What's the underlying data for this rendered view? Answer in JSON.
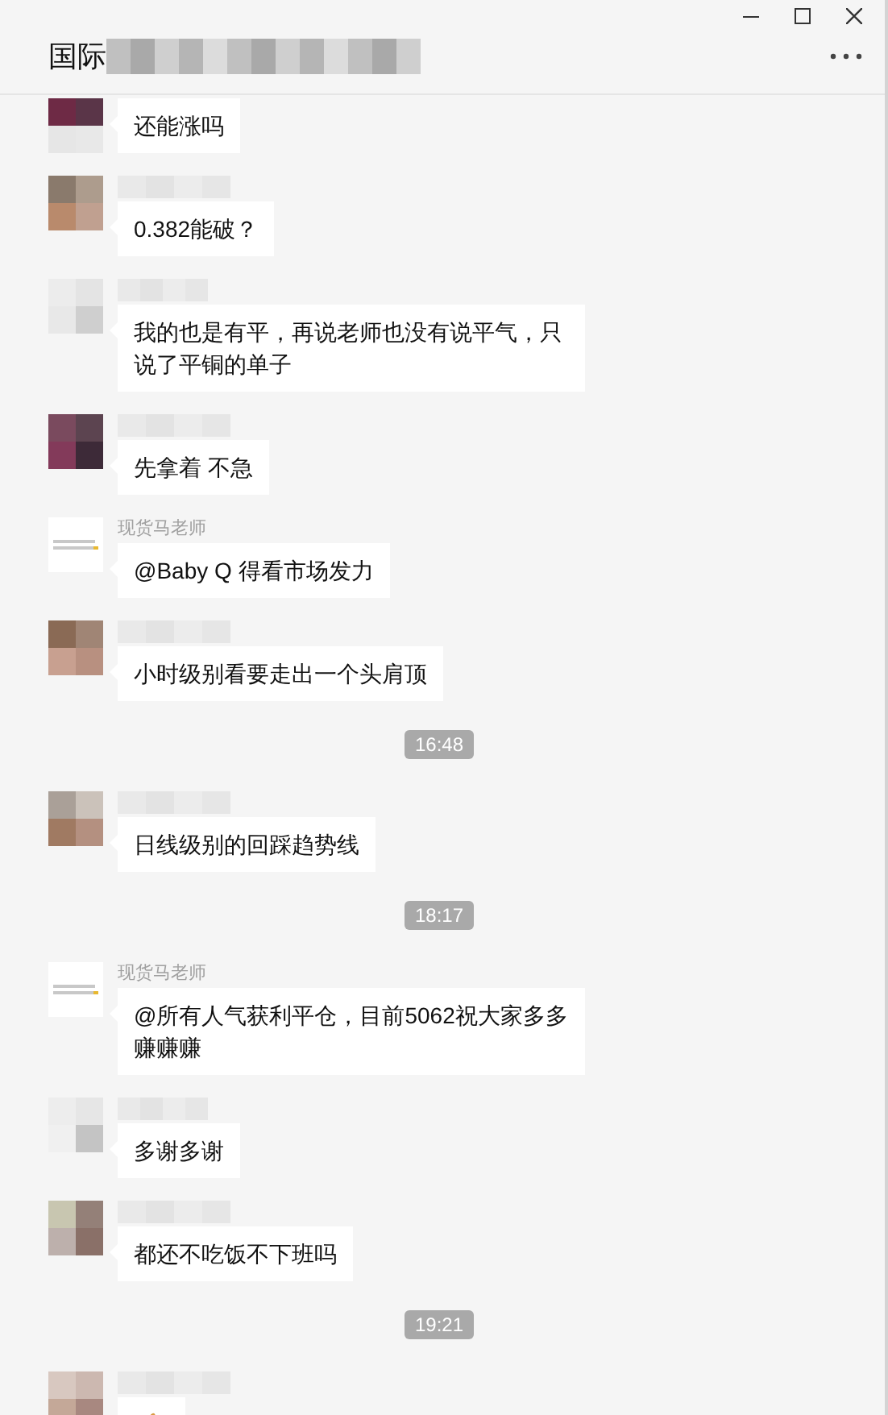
{
  "window": {
    "title": "国际"
  },
  "messages": [
    {
      "kind": "text",
      "text": "还能涨吗"
    },
    {
      "kind": "text",
      "text": "0.382能破？",
      "name_shown": false
    },
    {
      "kind": "text",
      "text": "我的也是有平，再说老师也没有说平气，只说了平铜的单子",
      "name_shown": false
    },
    {
      "kind": "text",
      "text": "先拿着 不急",
      "name_shown": false
    },
    {
      "kind": "text",
      "sender": "现货马老师",
      "text": "@Baby Q 得看市场发力",
      "name_shown": true
    },
    {
      "kind": "text",
      "text": "小时级别看要走出一个头肩顶",
      "name_shown": false
    },
    {
      "kind": "time",
      "text": "16:48"
    },
    {
      "kind": "text",
      "text": "日线级别的回踩趋势线",
      "name_shown": false
    },
    {
      "kind": "time",
      "text": "18:17"
    },
    {
      "kind": "text",
      "sender": "现货马老师",
      "text": "@所有人气获利平仓，目前5062祝大家多多赚赚赚",
      "name_shown": true
    },
    {
      "kind": "text",
      "text": "多谢多谢",
      "name_shown": false
    },
    {
      "kind": "text",
      "text": "都还不吃饭不下班吗",
      "name_shown": false
    },
    {
      "kind": "time",
      "text": "19:21"
    },
    {
      "kind": "sticker",
      "name_shown": false
    }
  ]
}
